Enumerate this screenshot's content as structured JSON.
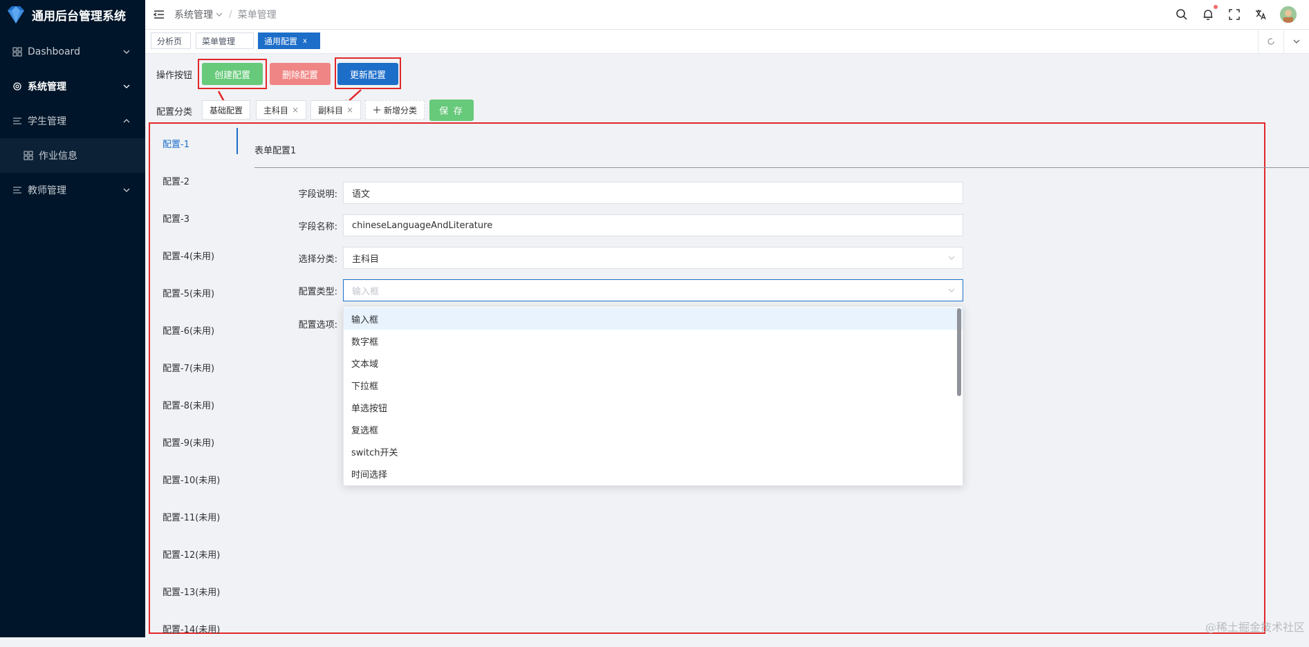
{
  "brand": {
    "title": "通用后台管理系统"
  },
  "sidebar": {
    "items": [
      {
        "label": "Dashboard"
      },
      {
        "label": "系统管理"
      },
      {
        "label": "学生管理"
      },
      {
        "label": "作业信息"
      },
      {
        "label": "教师管理"
      }
    ]
  },
  "header": {
    "breadcrumb": [
      "系统管理",
      "/",
      "菜单管理"
    ]
  },
  "tags": [
    "分析页",
    "菜单管理",
    "通用配置",
    "x"
  ],
  "toolbar": {
    "ops_label": "操作按钮",
    "create": "创建配置",
    "delete": "删除配置",
    "update": "更新配置",
    "cat_label": "配置分类",
    "categories": [
      "基础配置",
      "主科目",
      "副科目"
    ],
    "close_mark": "×",
    "add_category": "新增分类",
    "save": "保 存"
  },
  "config_list": [
    "配置-1",
    "配置-2",
    "配置-3",
    "配置-4(未用)",
    "配置-5(未用)",
    "配置-6(未用)",
    "配置-7(未用)",
    "配置-8(未用)",
    "配置-9(未用)",
    "配置-10(未用)",
    "配置-11(未用)",
    "配置-12(未用)",
    "配置-13(未用)",
    "配置-14(未用)"
  ],
  "form": {
    "title": "表单配置1",
    "field_desc_label": "字段说明:",
    "field_desc_value": "语文",
    "field_name_label": "字段名称:",
    "field_name_value": "chineseLanguageAndLiterature",
    "category_label": "选择分类:",
    "category_value": "主科目",
    "type_label": "配置类型:",
    "type_placeholder": "输入框",
    "options_label": "配置选项:"
  },
  "dropdown": [
    "输入框",
    "数字框",
    "文本域",
    "下拉框",
    "单选按钮",
    "复选框",
    "switch开关",
    "时间选择"
  ],
  "watermark": "@稀土掘金技术社区",
  "colors": {
    "primary": "#1d6ec9",
    "success": "#67c97a",
    "danger": "#f08585",
    "highlight": "#e3262a",
    "sidebar": "#001529"
  }
}
